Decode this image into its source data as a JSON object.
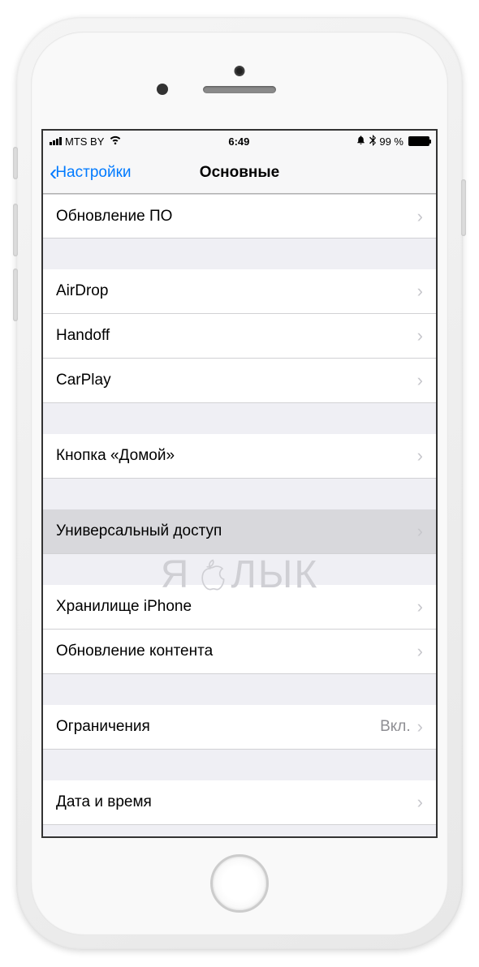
{
  "status_bar": {
    "carrier": "MTS BY",
    "time": "6:49",
    "battery_percent": "99 %",
    "alarm_icon": "⏰",
    "bluetooth_icon": "✱"
  },
  "nav": {
    "back_label": "Настройки",
    "title": "Основные"
  },
  "sections": [
    {
      "rows": [
        {
          "label": "Обновление ПО",
          "value": "",
          "key": "software-update"
        }
      ]
    },
    {
      "rows": [
        {
          "label": "AirDrop",
          "value": "",
          "key": "airdrop"
        },
        {
          "label": "Handoff",
          "value": "",
          "key": "handoff"
        },
        {
          "label": "CarPlay",
          "value": "",
          "key": "carplay"
        }
      ]
    },
    {
      "rows": [
        {
          "label": "Кнопка «Домой»",
          "value": "",
          "key": "home-button"
        }
      ]
    },
    {
      "rows": [
        {
          "label": "Универсальный доступ",
          "value": "",
          "key": "accessibility",
          "highlighted": true
        }
      ]
    },
    {
      "rows": [
        {
          "label": "Хранилище iPhone",
          "value": "",
          "key": "iphone-storage"
        },
        {
          "label": "Обновление контента",
          "value": "",
          "key": "background-app-refresh"
        }
      ]
    },
    {
      "rows": [
        {
          "label": "Ограничения",
          "value": "Вкл.",
          "key": "restrictions"
        }
      ]
    },
    {
      "rows": [
        {
          "label": "Дата и время",
          "value": "",
          "key": "date-time"
        }
      ]
    }
  ],
  "watermark": {
    "left": "Я",
    "right": "ЛЫК"
  }
}
